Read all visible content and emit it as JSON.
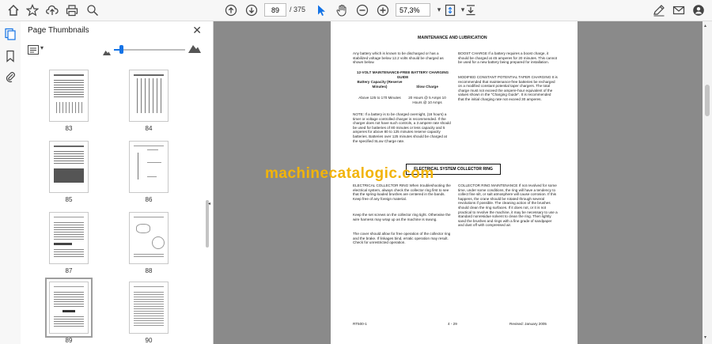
{
  "toolbar": {
    "page_current": "89",
    "page_total": "/ 375",
    "zoom": "57,3%"
  },
  "sidebar": {
    "title": "Page Thumbnails",
    "thumbnails": [
      "83",
      "84",
      "85",
      "86",
      "87",
      "88",
      "89",
      "90"
    ],
    "selected": "89"
  },
  "document": {
    "header": "MAINTENANCE AND LUBRICATION",
    "left_col": {
      "p1": "Any battery which is known to be discharged or has a stabilized voltage below 12.2 volts should be charged as shown below.",
      "guide_title": "12-VOLT MAINTENANCE-FREE BATTERY CHARGING GUIDE",
      "col1_head": "Battery Capacity (Reserve Minutes)",
      "col2_head": "Slow Charge",
      "col1_val": "Above 125 to 170 Minutes",
      "col2_val": "20 Hours @ 5 Amps 10 Hours @ 10 Amps",
      "note": "NOTE: If a battery is to be charged overnight, (16 hours) a timer or voltage controlled charger is recommended. If the charger does not have such controls, a 3 ampere rate should be used for batteries of 80 minutes or less capacity and 5 amperes for above 80 to 125 minutes reserve capacity batteries. Batteries over 125 minutes should be charged at the specified SLow Charge rate."
    },
    "right_col": {
      "p1": "BOOST CHARGE If a battery requires a boost charge, it should be charged at 45 amperes for 20 minutes. This cannot be used for a new battery being prepared for installation.",
      "p2": "MODIFIED CONSTANT POTENTIAL TAPER CHARGING It is recommended that maintenance-free batteries be recharged on a modified constant potential taper chargers. The total charge must not exceed the ampere-hour equivalent of the values shown in the \"Charging Guide\". It is recommended that the initial charging rate not exceed 30 amperes."
    },
    "collector_title": "ELECTRICAL SYSTEM COLLECTOR RING",
    "left_col2": {
      "p1": "ELECTRICAL COLLECTOR RING When troubleshooting the electrical system, always check the collector ring first to see that the spring-loaded brushes are centered in the bands. Keep free of any foreign material.",
      "p2": "Keep the set screws on the collector ring tight. Otherwise the wire harness may wrap up as the machine is swung.",
      "p3": "The cover should allow for free operation of the collector ring and the brake. If linkages bind, erratic operation may result. Check for unrestricted operation."
    },
    "right_col2": {
      "p1": "COLLECTOR RING MAINTENANCE If not revolved for some time, under some conditions, the ring will have a tendency to collect fine silt, or salt atmosphere will cause corrosion. If this happens, the crane should be rotated through several revolutions if possible. The cleaning action of the brushes should clean the ring surfaces. If it does not, or it is not practical to revolve the machine, it may be necessary to use a standard nonresidue solvent to clean the ring. Then lightly sand the brushes and rings with a fine grade of sandpaper and dust off with compressed air."
    },
    "footer_left": "RT500-1",
    "footer_center": "4 - 29",
    "footer_right": "Revised: January 2005"
  },
  "watermark": "machinecatalogic.com",
  "colors": {
    "accent": "#1473e6",
    "watermark": "#f2b40a",
    "doc_bg": "#8a8a8a"
  }
}
